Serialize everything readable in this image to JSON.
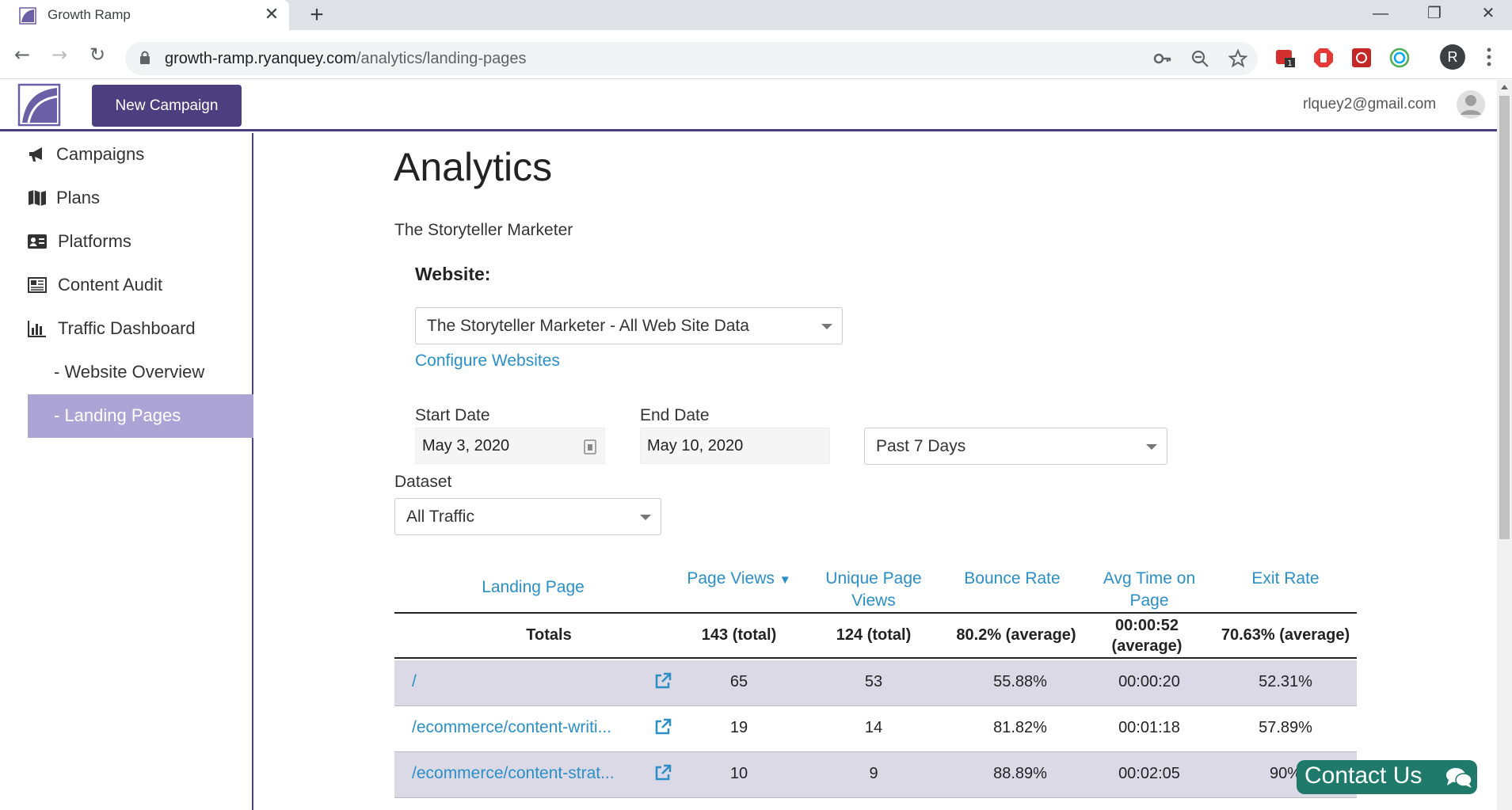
{
  "browser": {
    "tab_title": "Growth Ramp",
    "new_tab": "+",
    "url_host": "growth-ramp.ryanquey.com",
    "url_path": "/analytics/landing-pages",
    "profile_initial": "R",
    "extension_badge": "1"
  },
  "header": {
    "new_campaign_label": "New Campaign",
    "user_email": "rlquey2@gmail.com"
  },
  "sidebar": {
    "items": [
      {
        "label": "Campaigns",
        "icon": "megaphone-icon"
      },
      {
        "label": "Plans",
        "icon": "map-icon"
      },
      {
        "label": "Platforms",
        "icon": "id-card-icon"
      },
      {
        "label": "Content Audit",
        "icon": "newspaper-icon"
      },
      {
        "label": "Traffic Dashboard",
        "icon": "bar-chart-icon"
      },
      {
        "label": "- Website Overview"
      },
      {
        "label": "- Landing Pages",
        "active": true
      }
    ]
  },
  "main": {
    "title": "Analytics",
    "subtitle": "The Storyteller Marketer",
    "website_label": "Website:",
    "website_value": "The Storyteller Marketer - All Web Site Data",
    "configure_link": "Configure Websites",
    "start_date_label": "Start Date",
    "start_date_value": "May 3, 2020",
    "end_date_label": "End Date",
    "end_date_value": "May 10, 2020",
    "range_value": "Past 7 Days",
    "dataset_label": "Dataset",
    "dataset_value": "All Traffic"
  },
  "table": {
    "headers": {
      "landing_page": "Landing Page",
      "page_views": "Page Views",
      "unique_page_views": "Unique Page Views",
      "bounce_rate": "Bounce Rate",
      "avg_time": "Avg Time on Page",
      "exit_rate": "Exit Rate"
    },
    "totals": {
      "label": "Totals",
      "page_views": "143 (total)",
      "unique_page_views": "124 (total)",
      "bounce_rate": "80.2% (average)",
      "avg_time": "00:00:52 (average)",
      "exit_rate": "70.63% (average)"
    },
    "rows": [
      {
        "page": "/",
        "page_views": "65",
        "unique": "53",
        "bounce": "55.88%",
        "time": "00:00:20",
        "exit": "52.31%"
      },
      {
        "page": "/ecommerce/content-writi...",
        "page_views": "19",
        "unique": "14",
        "bounce": "81.82%",
        "time": "00:01:18",
        "exit": "57.89%"
      },
      {
        "page": "/ecommerce/content-strat...",
        "page_views": "10",
        "unique": "9",
        "bounce": "88.89%",
        "time": "00:02:05",
        "exit": "90%"
      }
    ]
  },
  "contact": {
    "label": "Contact Us"
  },
  "colors": {
    "brand": "#4b3f7f",
    "sidebar_active": "#aba4d4",
    "link": "#2a8fc7",
    "row_alt": "#dcd9e7",
    "contact": "#1f7a6b"
  }
}
